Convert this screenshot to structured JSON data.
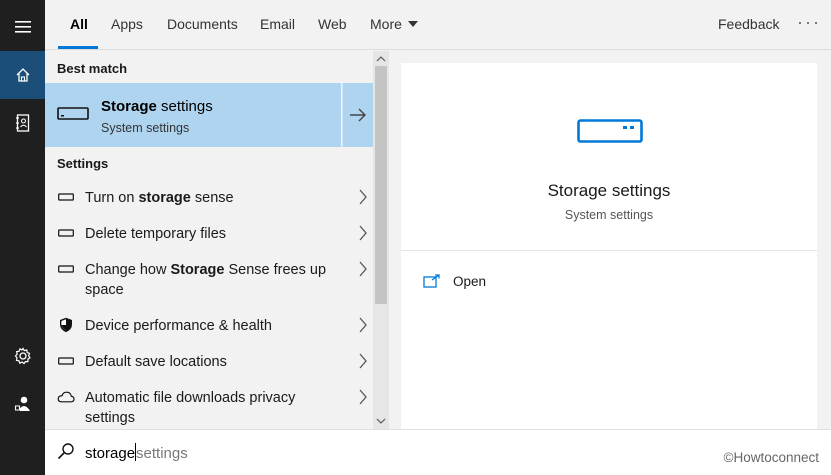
{
  "rail": {
    "items": [
      "menu-icon",
      "home-icon",
      "notebook-icon",
      "gear-icon",
      "person-icon"
    ]
  },
  "tabs": {
    "all": "All",
    "apps": "Apps",
    "documents": "Documents",
    "email": "Email",
    "web": "Web",
    "more": "More",
    "feedback": "Feedback",
    "overflow": "···"
  },
  "results": {
    "best_match_header": "Best match",
    "best": {
      "title_bold": "Storage",
      "title_rest": " settings",
      "subtitle": "System settings"
    },
    "settings_header": "Settings",
    "rows": [
      {
        "pre": "Turn on ",
        "bold": "storage",
        "post": " sense",
        "icon": "storage-icon"
      },
      {
        "pre": "Delete temporary files",
        "bold": "",
        "post": "",
        "icon": "storage-icon"
      },
      {
        "pre": "Change how ",
        "bold": "Storage",
        "post": " Sense frees up space",
        "icon": "storage-icon"
      },
      {
        "pre": "Device performance & health",
        "bold": "",
        "post": "",
        "icon": "shield-icon"
      },
      {
        "pre": "Default save locations",
        "bold": "",
        "post": "",
        "icon": "storage-icon"
      },
      {
        "pre": "Automatic file downloads privacy settings",
        "bold": "",
        "post": "",
        "icon": "cloud-icon"
      }
    ]
  },
  "detail": {
    "title": "Storage settings",
    "subtitle": "System settings",
    "open_label": "Open"
  },
  "search": {
    "typed": "storage",
    "hint": "settings"
  },
  "watermark": "©Howtoconnect",
  "colors": {
    "accent": "#0078d7",
    "highlight": "#aed4f0",
    "rail": "#1f1f1f",
    "rail_active": "#1b4f7a"
  }
}
